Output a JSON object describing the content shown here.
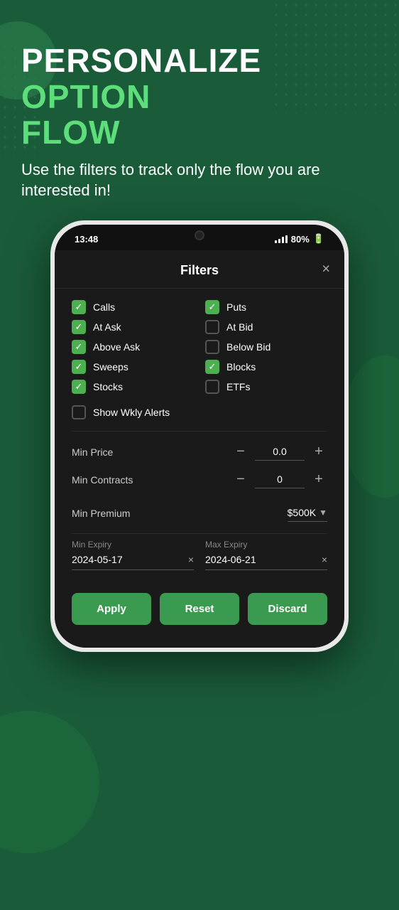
{
  "background": {
    "color": "#1a5c3a"
  },
  "header": {
    "title_part1": "PERSONALIZE ",
    "title_part2": "OPTION",
    "title_part3": "FLOW",
    "subtitle": "Use the filters to track only the flow you are interested in!"
  },
  "status_bar": {
    "time": "13:48",
    "signal": "80%",
    "battery_icon": "🔋"
  },
  "modal": {
    "title": "Filters",
    "close_label": "×",
    "checkboxes": [
      {
        "label": "Calls",
        "checked": true,
        "col": 0
      },
      {
        "label": "Puts",
        "checked": true,
        "col": 1
      },
      {
        "label": "At Ask",
        "checked": true,
        "col": 0
      },
      {
        "label": "At Bid",
        "checked": false,
        "col": 1
      },
      {
        "label": "Above Ask",
        "checked": true,
        "col": 0
      },
      {
        "label": "Below Bid",
        "checked": false,
        "col": 1
      },
      {
        "label": "Sweeps",
        "checked": true,
        "col": 0
      },
      {
        "label": "Blocks",
        "checked": true,
        "col": 1
      },
      {
        "label": "Stocks",
        "checked": true,
        "col": 0
      },
      {
        "label": "ETFs",
        "checked": false,
        "col": 1
      }
    ],
    "show_weekly": {
      "label": "Show Wkly Alerts",
      "checked": false
    },
    "min_price": {
      "label": "Min Price",
      "value": "0.0"
    },
    "min_contracts": {
      "label": "Min Contracts",
      "value": "0"
    },
    "min_premium": {
      "label": "Min Premium",
      "value": "$500K",
      "arrow": "▼"
    },
    "min_expiry": {
      "label": "Min Expiry",
      "value": "2024-05-17",
      "clear": "×"
    },
    "max_expiry": {
      "label": "Max Expiry",
      "value": "2024-06-21",
      "clear": "×"
    },
    "buttons": {
      "apply": "Apply",
      "reset": "Reset",
      "discard": "Discard"
    }
  }
}
